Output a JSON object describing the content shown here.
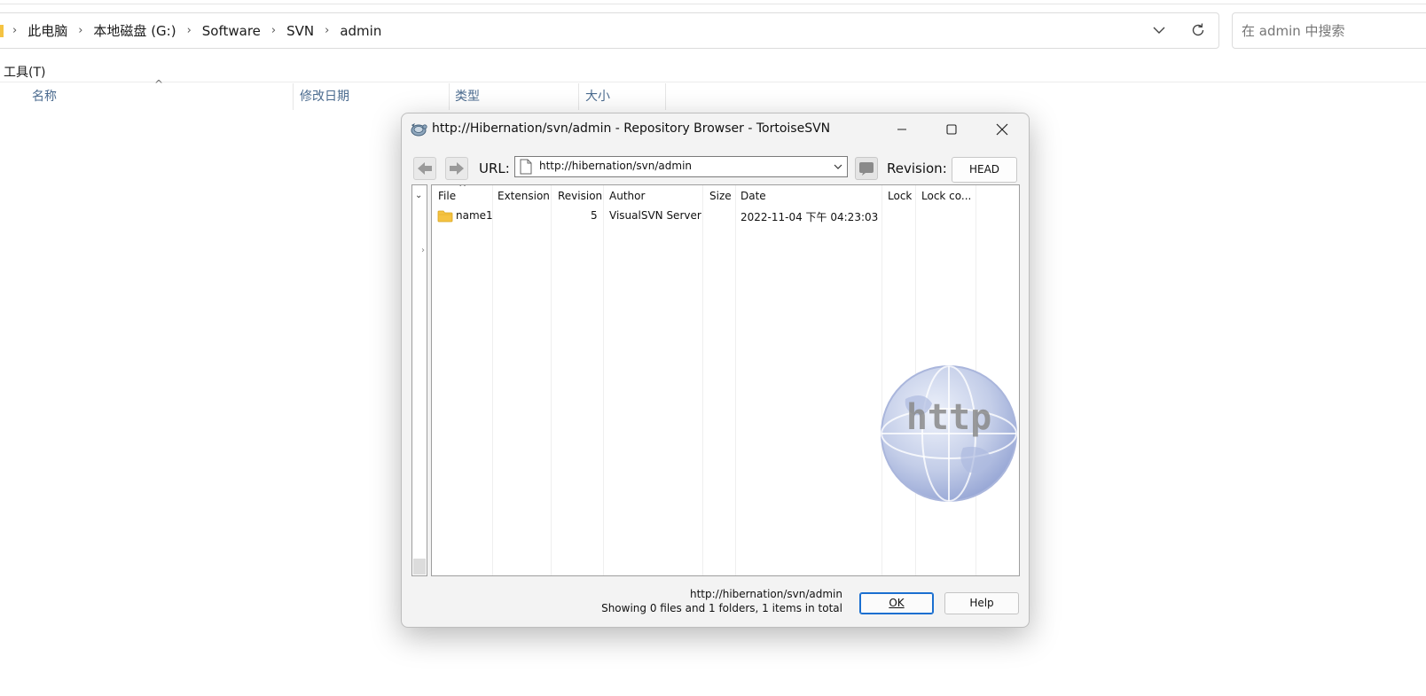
{
  "explorer": {
    "breadcrumb": [
      "此电脑",
      "本地磁盘 (G:)",
      "Software",
      "SVN",
      "admin"
    ],
    "search_placeholder": "在 admin 中搜索",
    "menu_tools": "工具(T)",
    "columns": [
      "名称",
      "修改日期",
      "类型",
      "大小"
    ]
  },
  "dialog": {
    "title": "http://Hibernation/svn/admin - Repository Browser - TortoiseSVN",
    "url_label": "URL:",
    "url_value": "http://hibernation/svn/admin",
    "revision_label": "Revision:",
    "revision_value": "HEAD",
    "list_columns": [
      "File",
      "Extension",
      "Revision",
      "Author",
      "Size",
      "Date",
      "Lock",
      "Lock co..."
    ],
    "rows": [
      {
        "file": "name1",
        "extension": "",
        "revision": "5",
        "author": "VisualSVN Server",
        "size": "",
        "date": "2022-11-04 下午 04:23:03",
        "lock": "",
        "lock_comment": ""
      }
    ],
    "watermark_text": "http",
    "status_url": "http://hibernation/svn/admin",
    "status_count": "Showing 0 files and 1 folders, 1 items in total",
    "ok_label": "OK",
    "help_label": "Help"
  },
  "colors": {
    "accent": "#1a6fd0",
    "folder": "#f5c342",
    "column_header_text": "#4b6b8f"
  }
}
